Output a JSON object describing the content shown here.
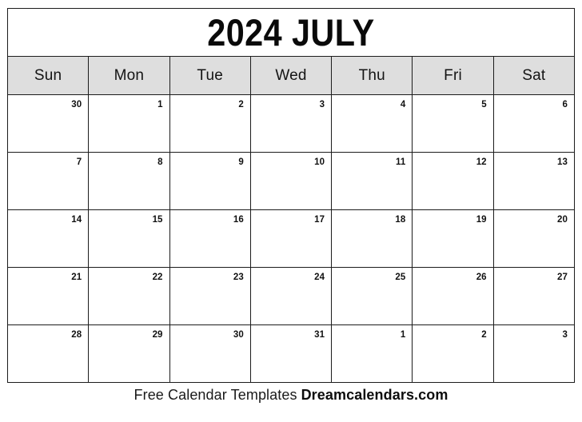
{
  "calendar": {
    "title": "2024 JULY",
    "year": "2024",
    "month": "JULY",
    "weekday_headers": [
      {
        "label": "Sun"
      },
      {
        "label": "Mon"
      },
      {
        "label": "Tue"
      },
      {
        "label": "Wed"
      },
      {
        "label": "Thu"
      },
      {
        "label": "Fri"
      },
      {
        "label": "Sat"
      }
    ],
    "weeks": [
      {
        "days": [
          {
            "number": "30",
            "in_month": false
          },
          {
            "number": "1",
            "in_month": true
          },
          {
            "number": "2",
            "in_month": true
          },
          {
            "number": "3",
            "in_month": true
          },
          {
            "number": "4",
            "in_month": true
          },
          {
            "number": "5",
            "in_month": true
          },
          {
            "number": "6",
            "in_month": true
          }
        ]
      },
      {
        "days": [
          {
            "number": "7",
            "in_month": true
          },
          {
            "number": "8",
            "in_month": true
          },
          {
            "number": "9",
            "in_month": true
          },
          {
            "number": "10",
            "in_month": true
          },
          {
            "number": "11",
            "in_month": true
          },
          {
            "number": "12",
            "in_month": true
          },
          {
            "number": "13",
            "in_month": true
          }
        ]
      },
      {
        "days": [
          {
            "number": "14",
            "in_month": true
          },
          {
            "number": "15",
            "in_month": true
          },
          {
            "number": "16",
            "in_month": true
          },
          {
            "number": "17",
            "in_month": true
          },
          {
            "number": "18",
            "in_month": true
          },
          {
            "number": "19",
            "in_month": true
          },
          {
            "number": "20",
            "in_month": true
          }
        ]
      },
      {
        "days": [
          {
            "number": "21",
            "in_month": true
          },
          {
            "number": "22",
            "in_month": true
          },
          {
            "number": "23",
            "in_month": true
          },
          {
            "number": "24",
            "in_month": true
          },
          {
            "number": "25",
            "in_month": true
          },
          {
            "number": "26",
            "in_month": true
          },
          {
            "number": "27",
            "in_month": true
          }
        ]
      },
      {
        "days": [
          {
            "number": "28",
            "in_month": true
          },
          {
            "number": "29",
            "in_month": true
          },
          {
            "number": "30",
            "in_month": true
          },
          {
            "number": "31",
            "in_month": true
          },
          {
            "number": "1",
            "in_month": false
          },
          {
            "number": "2",
            "in_month": false
          },
          {
            "number": "3",
            "in_month": false
          }
        ]
      }
    ]
  },
  "footer": {
    "text": "Free Calendar Templates",
    "brand": "Dreamcalendars.com"
  },
  "colors": {
    "header_background": "#dedede",
    "grid_line": "#1c1c1c",
    "page_background": "#ffffff",
    "text": "#111111"
  }
}
